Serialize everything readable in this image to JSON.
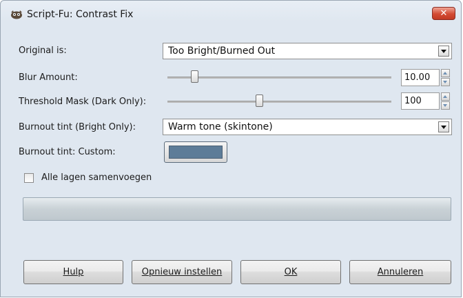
{
  "window": {
    "title": "Script-Fu: Contrast Fix",
    "close_symbol": "✕"
  },
  "fields": {
    "original": {
      "label": "Original is:",
      "value": "Too Bright/Burned Out"
    },
    "blur": {
      "label": "Blur Amount:",
      "value": "10.00",
      "slider_fraction": 0.12
    },
    "threshold": {
      "label": "Threshold Mask (Dark Only):",
      "value": "100",
      "slider_fraction": 0.41
    },
    "tint": {
      "label": "Burnout tint (Bright Only):",
      "value": "Warm tone (skintone)"
    },
    "custom": {
      "label": "Burnout tint: Custom:",
      "color": "#5d7c98"
    },
    "merge": {
      "label": "Alle lagen samenvoegen",
      "checked": false
    }
  },
  "buttons": {
    "help": "Hulp",
    "reset": "Opnieuw instellen",
    "ok": "OK",
    "cancel": "Annuleren"
  }
}
